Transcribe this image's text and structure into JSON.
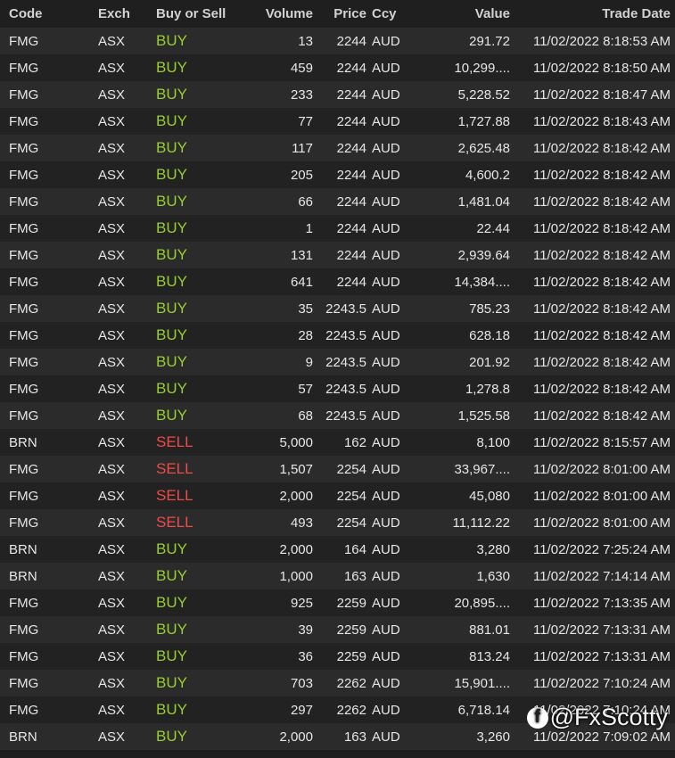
{
  "headers": {
    "code": "Code",
    "exch": "Exch",
    "side": "Buy or Sell",
    "volume": "Volume",
    "price": "Price",
    "ccy": "Ccy",
    "value": "Value",
    "date": "Trade Date"
  },
  "colors": {
    "buy": "#9acd32",
    "sell": "#ef4a4a"
  },
  "rows": [
    {
      "code": "FMG",
      "exch": "ASX",
      "side": "BUY",
      "volume": "13",
      "price": "2244",
      "ccy": "AUD",
      "value": "291.72",
      "date": "11/02/2022 8:18:53 AM"
    },
    {
      "code": "FMG",
      "exch": "ASX",
      "side": "BUY",
      "volume": "459",
      "price": "2244",
      "ccy": "AUD",
      "value": "10,299....",
      "date": "11/02/2022 8:18:50 AM"
    },
    {
      "code": "FMG",
      "exch": "ASX",
      "side": "BUY",
      "volume": "233",
      "price": "2244",
      "ccy": "AUD",
      "value": "5,228.52",
      "date": "11/02/2022 8:18:47 AM"
    },
    {
      "code": "FMG",
      "exch": "ASX",
      "side": "BUY",
      "volume": "77",
      "price": "2244",
      "ccy": "AUD",
      "value": "1,727.88",
      "date": "11/02/2022 8:18:43 AM"
    },
    {
      "code": "FMG",
      "exch": "ASX",
      "side": "BUY",
      "volume": "117",
      "price": "2244",
      "ccy": "AUD",
      "value": "2,625.48",
      "date": "11/02/2022 8:18:42 AM"
    },
    {
      "code": "FMG",
      "exch": "ASX",
      "side": "BUY",
      "volume": "205",
      "price": "2244",
      "ccy": "AUD",
      "value": "4,600.2",
      "date": "11/02/2022 8:18:42 AM"
    },
    {
      "code": "FMG",
      "exch": "ASX",
      "side": "BUY",
      "volume": "66",
      "price": "2244",
      "ccy": "AUD",
      "value": "1,481.04",
      "date": "11/02/2022 8:18:42 AM"
    },
    {
      "code": "FMG",
      "exch": "ASX",
      "side": "BUY",
      "volume": "1",
      "price": "2244",
      "ccy": "AUD",
      "value": "22.44",
      "date": "11/02/2022 8:18:42 AM"
    },
    {
      "code": "FMG",
      "exch": "ASX",
      "side": "BUY",
      "volume": "131",
      "price": "2244",
      "ccy": "AUD",
      "value": "2,939.64",
      "date": "11/02/2022 8:18:42 AM"
    },
    {
      "code": "FMG",
      "exch": "ASX",
      "side": "BUY",
      "volume": "641",
      "price": "2244",
      "ccy": "AUD",
      "value": "14,384....",
      "date": "11/02/2022 8:18:42 AM"
    },
    {
      "code": "FMG",
      "exch": "ASX",
      "side": "BUY",
      "volume": "35",
      "price": "2243.5",
      "ccy": "AUD",
      "value": "785.23",
      "date": "11/02/2022 8:18:42 AM"
    },
    {
      "code": "FMG",
      "exch": "ASX",
      "side": "BUY",
      "volume": "28",
      "price": "2243.5",
      "ccy": "AUD",
      "value": "628.18",
      "date": "11/02/2022 8:18:42 AM"
    },
    {
      "code": "FMG",
      "exch": "ASX",
      "side": "BUY",
      "volume": "9",
      "price": "2243.5",
      "ccy": "AUD",
      "value": "201.92",
      "date": "11/02/2022 8:18:42 AM"
    },
    {
      "code": "FMG",
      "exch": "ASX",
      "side": "BUY",
      "volume": "57",
      "price": "2243.5",
      "ccy": "AUD",
      "value": "1,278.8",
      "date": "11/02/2022 8:18:42 AM"
    },
    {
      "code": "FMG",
      "exch": "ASX",
      "side": "BUY",
      "volume": "68",
      "price": "2243.5",
      "ccy": "AUD",
      "value": "1,525.58",
      "date": "11/02/2022 8:18:42 AM"
    },
    {
      "code": "BRN",
      "exch": "ASX",
      "side": "SELL",
      "volume": "5,000",
      "price": "162",
      "ccy": "AUD",
      "value": "8,100",
      "date": "11/02/2022 8:15:57 AM"
    },
    {
      "code": "FMG",
      "exch": "ASX",
      "side": "SELL",
      "volume": "1,507",
      "price": "2254",
      "ccy": "AUD",
      "value": "33,967....",
      "date": "11/02/2022 8:01:00 AM"
    },
    {
      "code": "FMG",
      "exch": "ASX",
      "side": "SELL",
      "volume": "2,000",
      "price": "2254",
      "ccy": "AUD",
      "value": "45,080",
      "date": "11/02/2022 8:01:00 AM"
    },
    {
      "code": "FMG",
      "exch": "ASX",
      "side": "SELL",
      "volume": "493",
      "price": "2254",
      "ccy": "AUD",
      "value": "11,112.22",
      "date": "11/02/2022 8:01:00 AM"
    },
    {
      "code": "BRN",
      "exch": "ASX",
      "side": "BUY",
      "volume": "2,000",
      "price": "164",
      "ccy": "AUD",
      "value": "3,280",
      "date": "11/02/2022 7:25:24 AM"
    },
    {
      "code": "BRN",
      "exch": "ASX",
      "side": "BUY",
      "volume": "1,000",
      "price": "163",
      "ccy": "AUD",
      "value": "1,630",
      "date": "11/02/2022 7:14:14 AM"
    },
    {
      "code": "FMG",
      "exch": "ASX",
      "side": "BUY",
      "volume": "925",
      "price": "2259",
      "ccy": "AUD",
      "value": "20,895....",
      "date": "11/02/2022 7:13:35 AM"
    },
    {
      "code": "FMG",
      "exch": "ASX",
      "side": "BUY",
      "volume": "39",
      "price": "2259",
      "ccy": "AUD",
      "value": "881.01",
      "date": "11/02/2022 7:13:31 AM"
    },
    {
      "code": "FMG",
      "exch": "ASX",
      "side": "BUY",
      "volume": "36",
      "price": "2259",
      "ccy": "AUD",
      "value": "813.24",
      "date": "11/02/2022 7:13:31 AM"
    },
    {
      "code": "FMG",
      "exch": "ASX",
      "side": "BUY",
      "volume": "703",
      "price": "2262",
      "ccy": "AUD",
      "value": "15,901....",
      "date": "11/02/2022 7:10:24 AM"
    },
    {
      "code": "FMG",
      "exch": "ASX",
      "side": "BUY",
      "volume": "297",
      "price": "2262",
      "ccy": "AUD",
      "value": "6,718.14",
      "date": "11/02/2022 7:10:24 AM"
    },
    {
      "code": "BRN",
      "exch": "ASX",
      "side": "BUY",
      "volume": "2,000",
      "price": "163",
      "ccy": "AUD",
      "value": "3,260",
      "date": "11/02/2022 7:09:02 AM"
    }
  ],
  "watermark": {
    "icon": "facebook-icon",
    "text": "@FxScotty"
  }
}
